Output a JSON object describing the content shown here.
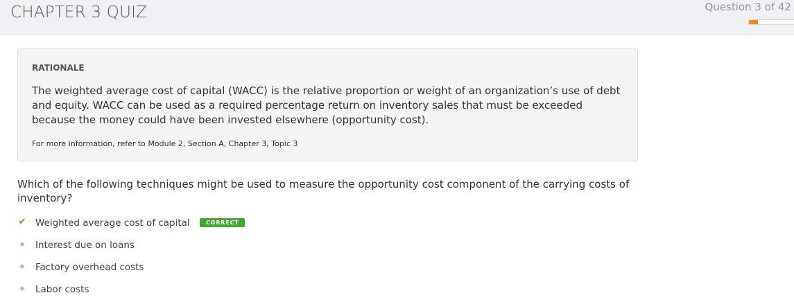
{
  "header": {
    "title": "CHAPTER 3 QUIZ",
    "question_counter": "Question 3 of 42",
    "progress_percent": 7.1
  },
  "rationale": {
    "heading": "RATIONALE",
    "text": "The weighted average cost of capital (WACC) is the relative proportion or weight of an organization’s use of debt and equity. WACC can be used as a required percentage return on inventory sales that must be exceeded because the money could have been invested elsewhere (opportunity cost).",
    "reference": "For more information, refer to Module 2, Section A, Chapter 3, Topic 3"
  },
  "question": "Which of the following techniques might be used to measure the opportunity cost component of the carrying costs of inventory?",
  "answers": [
    {
      "label": "Weighted average cost of capital",
      "badge": "CORRECT",
      "icon": "check-icon"
    },
    {
      "label": "Interest due on loans",
      "icon": "bullet-icon"
    },
    {
      "label": "Factory overhead costs",
      "icon": "bullet-icon"
    },
    {
      "label": "Labor costs",
      "icon": "bullet-icon"
    }
  ],
  "colors": {
    "accent": "#f28c1c",
    "correct": "#43a830"
  }
}
